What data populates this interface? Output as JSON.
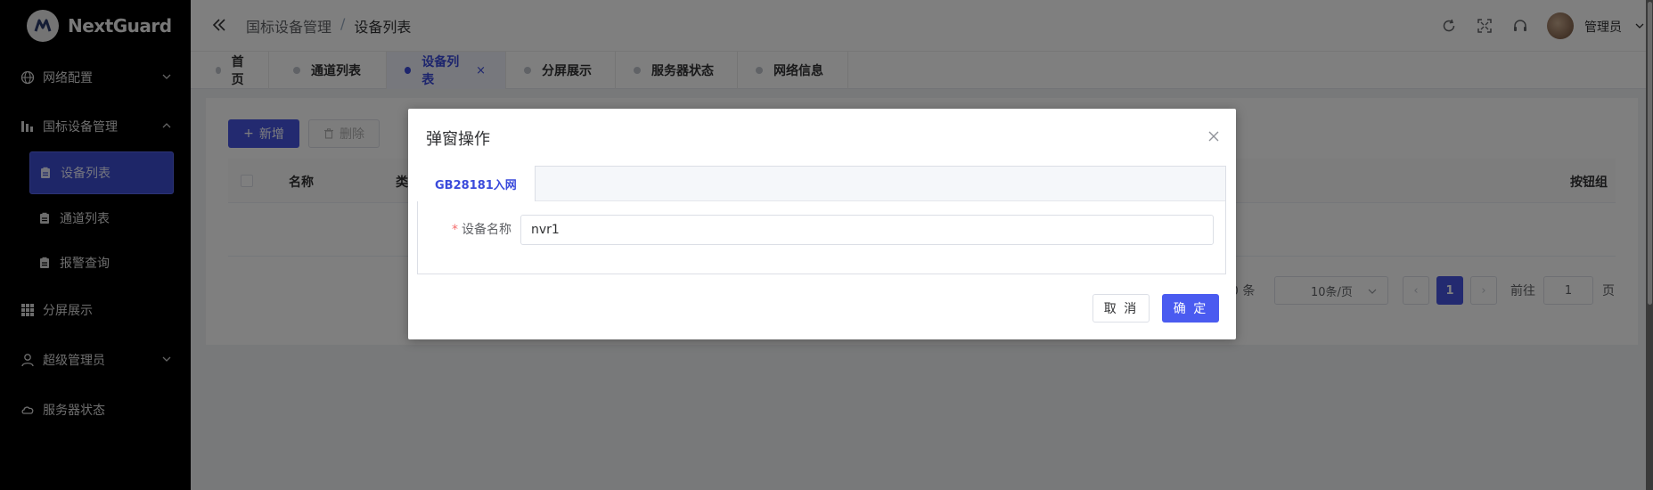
{
  "app": {
    "brand": "NextGuard"
  },
  "sidebar": {
    "items": [
      {
        "label": "网络配置",
        "icon": "globe-icon",
        "expandable": true
      },
      {
        "label": "国标设备管理",
        "icon": "chart-bars-icon",
        "expandable": true,
        "expanded": true
      },
      {
        "label": "分屏展示",
        "icon": "grid-icon",
        "expandable": false
      },
      {
        "label": "超级管理员",
        "icon": "user-icon",
        "expandable": true
      },
      {
        "label": "服务器状态",
        "icon": "cloud-icon",
        "expandable": false
      }
    ],
    "subitems": [
      {
        "label": "设备列表",
        "active": true
      },
      {
        "label": "通道列表",
        "active": false
      },
      {
        "label": "报警查询",
        "active": false
      }
    ]
  },
  "header": {
    "breadcrumb": [
      "国标设备管理",
      "/",
      "设备列表"
    ],
    "username": "管理员"
  },
  "tabs": [
    {
      "label": "首页"
    },
    {
      "label": "通道列表"
    },
    {
      "label": "设备列表",
      "active": true,
      "close": "×"
    },
    {
      "label": "分屏展示"
    },
    {
      "label": "服务器状态"
    },
    {
      "label": "网络信息"
    }
  ],
  "toolbar": {
    "add_label": "新增",
    "delete_label": "删除"
  },
  "table": {
    "columns": [
      "名称",
      "类",
      "按钮组"
    ]
  },
  "pagination": {
    "total_text": "0 条",
    "page_size": "10条/页",
    "current_page": "1",
    "prev": "‹",
    "next": "›",
    "goto_label": "前往",
    "goto_value": "1",
    "page_unit": "页"
  },
  "dialog": {
    "title": "弹窗操作",
    "tab_label": "GB28181入网",
    "field_label": "设备名称",
    "required_mark": "*",
    "field_value": "nvr1",
    "cancel_label": "取 消",
    "ok_label": "确 定"
  },
  "colors": {
    "primary": "#4655e0",
    "sidebar_bg": "#000000",
    "active_sub": "#3d4cd0"
  }
}
